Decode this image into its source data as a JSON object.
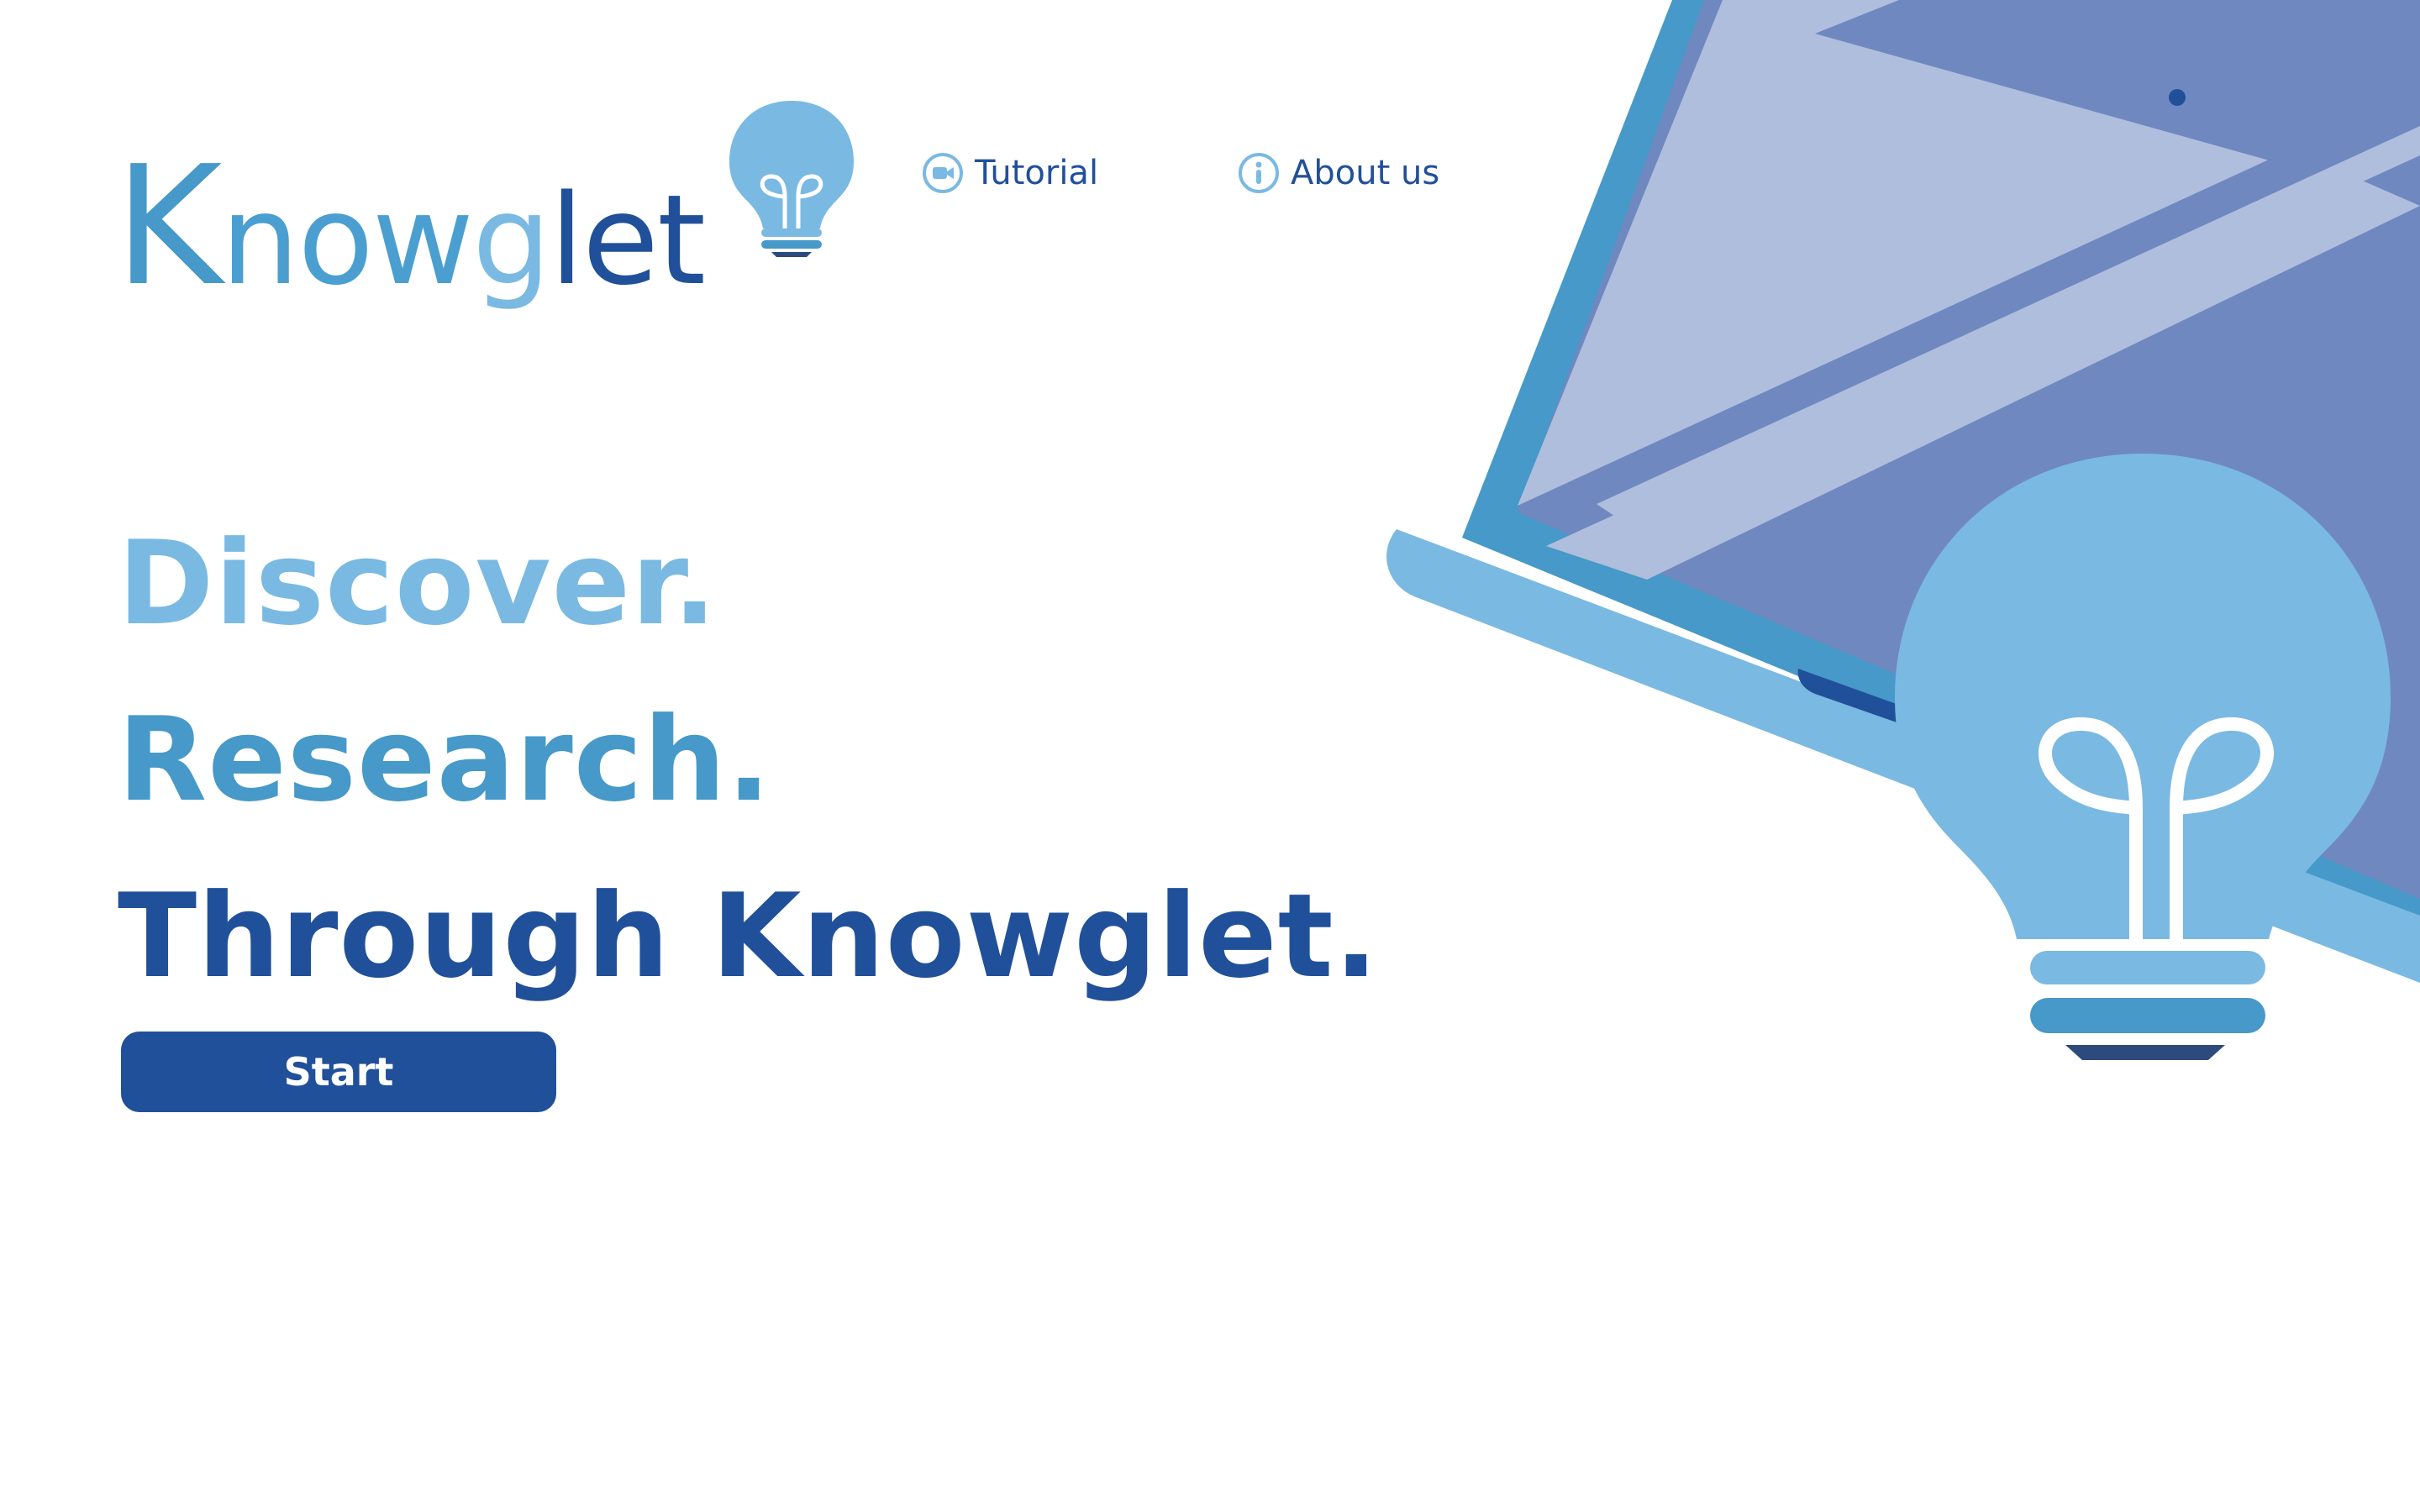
{
  "brand": {
    "logo_letters": [
      "K",
      "now",
      "g",
      "let"
    ],
    "colors": {
      "light_blue": "#7ab9e2",
      "mid_blue": "#4699c8",
      "dark_blue": "#21509a",
      "screen_purple": "#7088c0",
      "screen_light": "#afbedd"
    }
  },
  "nav": {
    "tutorial": {
      "label": "Tutorial",
      "icon": "video-camera-icon"
    },
    "about": {
      "label": "About us",
      "icon": "info-icon"
    }
  },
  "hero": {
    "line1": "Discover.",
    "line2": "Research.",
    "line3": "Through Knowglet.",
    "cta_label": "Start"
  },
  "illustration": {
    "items": [
      "laptop-illustration",
      "lightbulb-illustration"
    ]
  }
}
